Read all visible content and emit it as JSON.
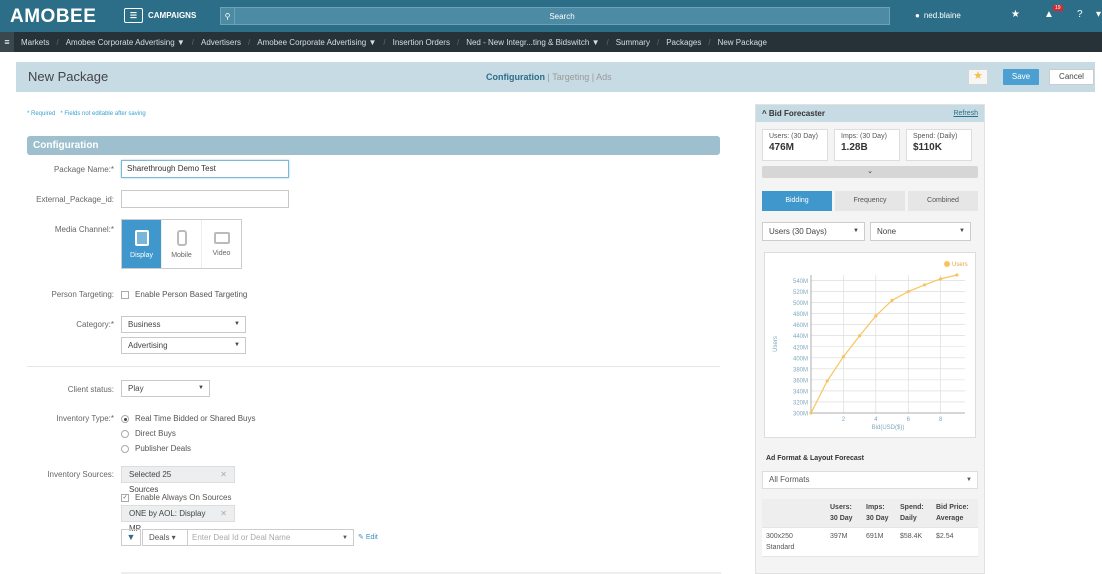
{
  "topbar": {
    "logo": "AMOBEE",
    "campaigns_label": "CAMPAIGNS",
    "search_label": "Search",
    "user_name": "ned.blaine",
    "notification_count": "19"
  },
  "breadcrumbs": [
    "Markets",
    "Amobee Corporate Advertising ▼",
    "Advertisers",
    "Amobee Corporate Advertising ▼",
    "Insertion Orders",
    "Ned - New Integr...ting & Bidswitch ▼",
    "Summary",
    "Packages",
    "New Package"
  ],
  "header": {
    "title": "New Package",
    "steps": [
      "Configuration",
      "Targeting",
      "Ads"
    ],
    "save_label": "Save",
    "cancel_label": "Cancel"
  },
  "legend": {
    "required": "* Required",
    "not_editable": "* Fields not editable after saving"
  },
  "config": {
    "section_title": "Configuration",
    "package_name_label": "Package Name:*",
    "package_name_value": "Sharethrough Demo Test",
    "external_id_label": "External_Package_id:",
    "external_id_value": "",
    "media_channel_label": "Media Channel:*",
    "media_options": [
      "Display",
      "Mobile",
      "Video"
    ],
    "person_targeting_label": "Person Targeting:",
    "person_targeting_option": "Enable Person Based Targeting",
    "category_label": "Category:*",
    "category_value": "Business",
    "subcategory_value": "Advertising",
    "client_status_label": "Client status:",
    "client_status_value": "Play",
    "inventory_type_label": "Inventory Type:*",
    "inventory_type_options": [
      "Real Time Bidded or Shared Buys",
      "Direct Buys",
      "Publisher Deals"
    ],
    "inventory_sources_label": "Inventory Sources:",
    "inventory_sources_tag": "Selected 25 Sources",
    "always_on_label": "Enable Always On Sources",
    "always_on_tag": "ONE by AOL: Display MP",
    "deals_select": "Deals",
    "deals_placeholder": "Enter Deal Id or Deal Name",
    "edit_label": "Edit"
  },
  "forecaster": {
    "title": "Bid Forecaster",
    "refresh": "Refresh",
    "stats": [
      {
        "label": "Users: (30 Day)",
        "value": "476M"
      },
      {
        "label": "Imps: (30 Day)",
        "value": "1.28B"
      },
      {
        "label": "Spend: (Daily)",
        "value": "$110K"
      }
    ],
    "tabs": [
      "Bidding",
      "Frequency",
      "Combined"
    ],
    "metric_select": "Users (30 Days)",
    "compare_select": "None",
    "ad_format_title": "Ad Format & Layout Forecast",
    "ad_format_select": "All Formats",
    "table_headers": [
      "",
      "Users: 30 Day",
      "Imps: 30 Day",
      "Spend: Daily",
      "Bid Price: Average"
    ],
    "table_rows": [
      [
        "300x250 Standard",
        "397M",
        "691M",
        "$58.4K",
        "$2.54"
      ]
    ]
  },
  "chart_data": {
    "type": "line",
    "title": "",
    "xlabel": "Bid(USD($))",
    "ylabel": "Users",
    "legend": [
      "Users"
    ],
    "legend_position": "top-right",
    "x": [
      0,
      1,
      2,
      3,
      4,
      5,
      6,
      7,
      8,
      9
    ],
    "series": [
      {
        "name": "Users",
        "values": [
          300,
          358,
          402,
          440,
          476,
          504,
          520,
          532,
          543,
          550
        ]
      }
    ],
    "xticks": [
      2,
      4,
      6,
      8
    ],
    "yticks": [
      "300M",
      "320M",
      "340M",
      "360M",
      "380M",
      "400M",
      "420M",
      "440M",
      "460M",
      "480M",
      "500M",
      "520M",
      "540M"
    ],
    "xlim": [
      0,
      9.5
    ],
    "ylim": [
      300,
      550
    ],
    "grid": true,
    "color": "#f7c55f"
  }
}
